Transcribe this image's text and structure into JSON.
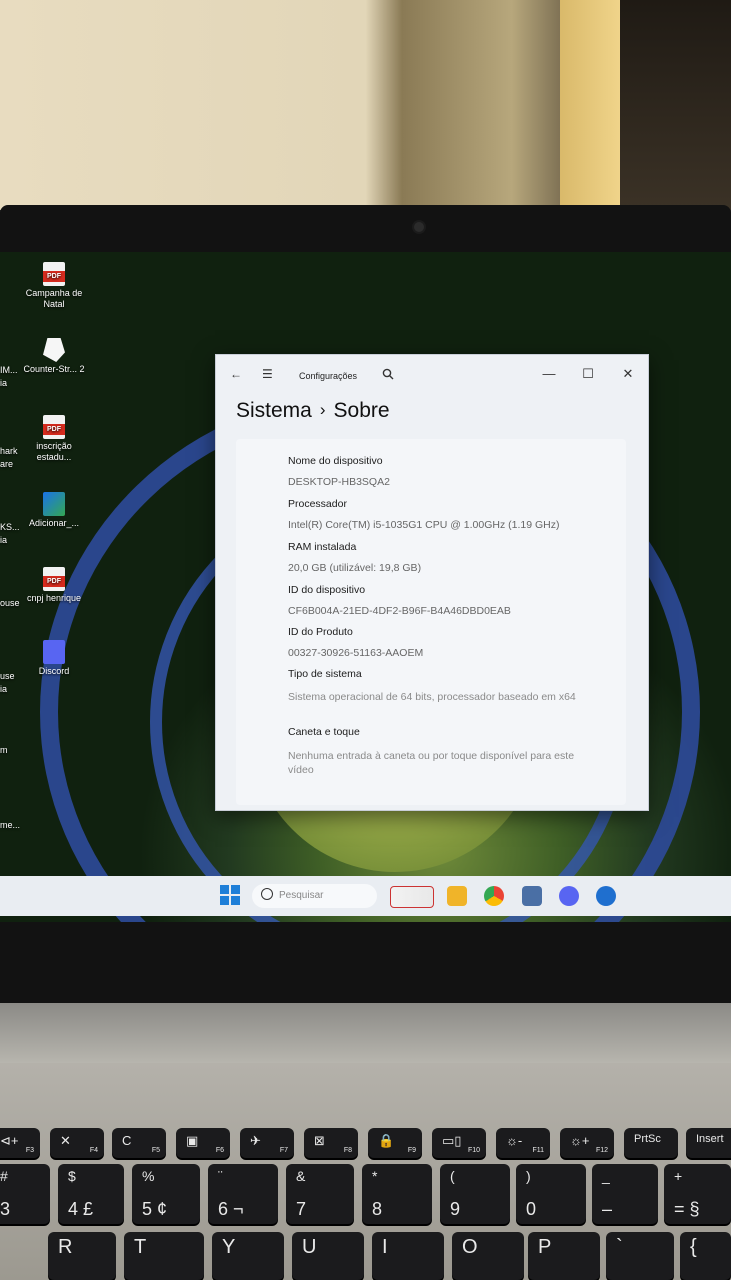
{
  "desktop": {
    "icons": [
      {
        "label": "Campanha de Natal"
      },
      {
        "label": "Counter-Str... 2"
      },
      {
        "label": "inscrição estadu..."
      },
      {
        "label": "Adicionar_..."
      },
      {
        "label": "cnpj henrique"
      },
      {
        "label": "Discord"
      }
    ],
    "partial_labels": [
      "IM...",
      "ia",
      "hark",
      "are",
      "KS...",
      "ia",
      "ouse",
      "use",
      "ia",
      "m",
      "me..."
    ]
  },
  "window": {
    "app_title": "Configurações",
    "breadcrumb": {
      "parent": "Sistema",
      "current": "Sobre"
    },
    "controls": {
      "minimize": "—",
      "maximize": "☐",
      "close": "✕"
    },
    "specs": [
      {
        "label": "Nome do dispositivo",
        "value": "DESKTOP-HB3SQA2"
      },
      {
        "label": "Processador",
        "value": "Intel(R) Core(TM) i5-1035G1 CPU @ 1.00GHz (1.19 GHz)"
      },
      {
        "label": "RAM instalada",
        "value": "20,0 GB (utilizável: 19,8 GB)"
      },
      {
        "label": "ID do dispositivo",
        "value": "CF6B004A-21ED-4DF2-B96F-B4A46DBD0EAB"
      },
      {
        "label": "ID do Produto",
        "value": "00327-30926-51163-AAOEM"
      },
      {
        "label": "Tipo de sistema",
        "value": "Sistema operacional de 64 bits, processador baseado em x64"
      },
      {
        "label": "Caneta e toque",
        "value": "Nenhuma entrada à caneta ou por toque disponível para este vídeo"
      }
    ]
  },
  "taskbar": {
    "search_placeholder": "Pesquisar"
  },
  "keyboard": {
    "fn_row": [
      {
        "top": "⊲+",
        "sub": "F3"
      },
      {
        "top": "✕",
        "sub": "F4"
      },
      {
        "top": "C",
        "sub": "F5"
      },
      {
        "top": "▣",
        "sub": "F6"
      },
      {
        "top": "✈",
        "sub": "F7"
      },
      {
        "top": "⊠",
        "sub": "F8"
      },
      {
        "top": "🔒",
        "sub": "F9"
      },
      {
        "top": "▭▯",
        "sub": "F10"
      },
      {
        "top": "☼-",
        "sub": "F11"
      },
      {
        "top": "☼+",
        "sub": "F12"
      },
      {
        "top": "PrtSc",
        "sub": ""
      },
      {
        "top": "Insert",
        "sub": ""
      }
    ],
    "num_row": [
      {
        "top": "#",
        "bottom": "3"
      },
      {
        "top": "$",
        "bottom": "4 £"
      },
      {
        "top": "%",
        "bottom": "5 ¢"
      },
      {
        "top": "¨",
        "bottom": "6 ¬"
      },
      {
        "top": "&",
        "bottom": "7"
      },
      {
        "top": "*",
        "bottom": "8"
      },
      {
        "top": "(",
        "bottom": "9"
      },
      {
        "top": ")",
        "bottom": "0"
      },
      {
        "top": "_",
        "bottom": "–"
      },
      {
        "top": "+",
        "bottom": "= §"
      }
    ],
    "letter_row": [
      "R",
      "T",
      "Y",
      "U",
      "I",
      "O",
      "P",
      "`",
      "{"
    ]
  }
}
